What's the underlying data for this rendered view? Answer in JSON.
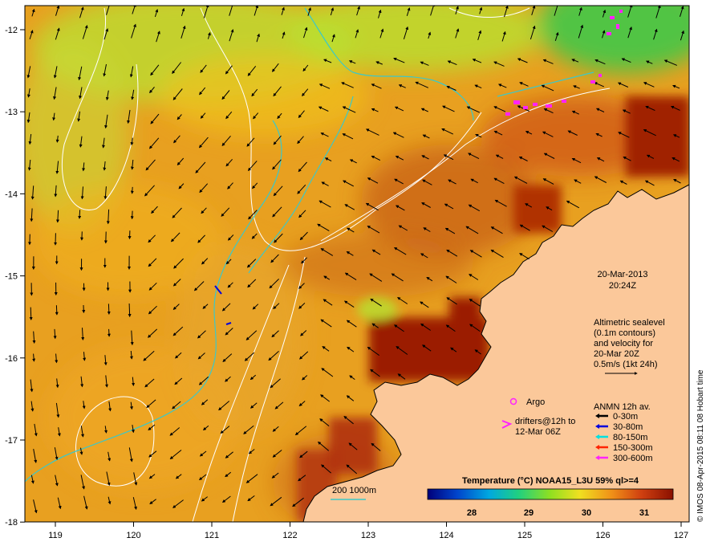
{
  "map": {
    "lon_ticks": [
      "119",
      "120",
      "121",
      "122",
      "123",
      "124",
      "125",
      "126",
      "127"
    ],
    "lat_ticks": [
      "-12",
      "-13",
      "-14",
      "-15",
      "-16",
      "-17",
      "-18"
    ],
    "timestamp_date": "20-Mar-2013",
    "timestamp_time": "20:24Z",
    "altimetry_lines": [
      "Altimetric sealevel",
      "(0.1m contours)",
      "and velocity for",
      "20-Mar 20Z",
      "0.5m/s (1kt 24h)"
    ],
    "argo_label": "Argo",
    "drifters_lines": [
      "drifters@12h to",
      "12-Mar 06Z"
    ],
    "anmn_title": "ANMN 12h av.",
    "anmn_items": [
      {
        "label": "0-30m",
        "color": "#000000"
      },
      {
        "label": "30-80m",
        "color": "#0000dd"
      },
      {
        "label": "80-150m",
        "color": "#00e0e0"
      },
      {
        "label": "150-300m",
        "color": "#ff2200"
      },
      {
        "label": "300-600m",
        "color": "#ff22ff"
      }
    ],
    "colorbar_title": "Temperature (°C) NOAA15_L3U 59% ql>=4",
    "colorbar_ticks": [
      "28",
      "29",
      "30",
      "31"
    ],
    "bathy_label": "200  1000m",
    "credit": "© IMOS 08-Apr-2015 08:11 08 Hobart time",
    "colors": {
      "land": "#fbc89a",
      "sst_warm": "#e8a020",
      "sst_hot": "#9b1a00",
      "sst_cool": "#b8e030",
      "contour": "#ffffff",
      "bathy": "#3cc8c8"
    }
  }
}
